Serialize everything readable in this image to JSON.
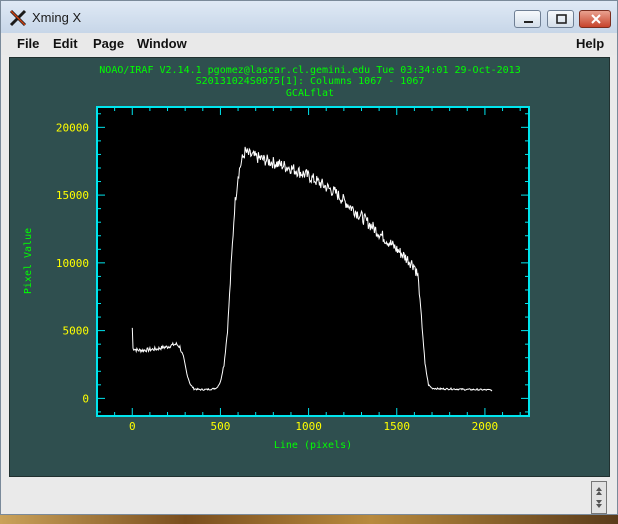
{
  "window": {
    "title": "Xming X",
    "icon": "xming-x-icon",
    "controls": [
      "minimize-icon",
      "maximize-icon",
      "close-icon"
    ]
  },
  "menubar": {
    "items": [
      "File",
      "Edit",
      "Page",
      "Window"
    ],
    "help": "Help"
  },
  "colors": {
    "canvas_bg": "#2f4f4f",
    "header_text": "#00ff00",
    "axis_labels": "#ffff00",
    "axis_frame": "#00e5ee",
    "data_line": "#ffffff"
  },
  "chart_data": {
    "type": "line",
    "title_lines": [
      "NOAO/IRAF V2.14.1 pgomez@lascar.cl.gemini.edu Tue 03:34:01 29-Oct-2013",
      "S20131024S0075[1]: Columns 1067 - 1067",
      "GCALflat"
    ],
    "xlabel": "Line (pixels)",
    "ylabel": "Pixel Value",
    "xlim": [
      -200,
      2250
    ],
    "ylim": [
      -1300,
      21500
    ],
    "x_ticks": [
      0,
      500,
      1000,
      1500,
      2000
    ],
    "y_ticks": [
      0,
      5000,
      10000,
      15000,
      20000
    ],
    "grid": false,
    "series": [
      {
        "values": [
          [
            0,
            5200
          ],
          [
            4,
            3700
          ],
          [
            30,
            3550
          ],
          [
            60,
            3550
          ],
          [
            100,
            3600
          ],
          [
            140,
            3650
          ],
          [
            170,
            3750
          ],
          [
            200,
            3800
          ],
          [
            230,
            3950
          ],
          [
            250,
            4000
          ],
          [
            270,
            3800
          ],
          [
            290,
            3000
          ],
          [
            310,
            1800
          ],
          [
            330,
            1000
          ],
          [
            350,
            700
          ],
          [
            380,
            650
          ],
          [
            420,
            650
          ],
          [
            460,
            700
          ],
          [
            480,
            800
          ],
          [
            500,
            1200
          ],
          [
            520,
            2500
          ],
          [
            540,
            5000
          ],
          [
            560,
            9500
          ],
          [
            580,
            14000
          ],
          [
            600,
            16500
          ],
          [
            620,
            17500
          ],
          [
            640,
            18200
          ],
          [
            660,
            18000
          ],
          [
            700,
            17800
          ],
          [
            750,
            17600
          ],
          [
            800,
            17400
          ],
          [
            850,
            17200
          ],
          [
            900,
            17000
          ],
          [
            950,
            16700
          ],
          [
            1000,
            16400
          ],
          [
            1050,
            16000
          ],
          [
            1100,
            15600
          ],
          [
            1150,
            15200
          ],
          [
            1200,
            14600
          ],
          [
            1250,
            14000
          ],
          [
            1300,
            13400
          ],
          [
            1350,
            12800
          ],
          [
            1400,
            12200
          ],
          [
            1450,
            11600
          ],
          [
            1500,
            11000
          ],
          [
            1550,
            10400
          ],
          [
            1600,
            9800
          ],
          [
            1620,
            9000
          ],
          [
            1640,
            6000
          ],
          [
            1660,
            2500
          ],
          [
            1680,
            1000
          ],
          [
            1700,
            750
          ],
          [
            1750,
            700
          ],
          [
            1800,
            700
          ],
          [
            1850,
            680
          ],
          [
            1900,
            650
          ],
          [
            1950,
            650
          ],
          [
            2000,
            630
          ],
          [
            2040,
            620
          ]
        ]
      }
    ]
  }
}
